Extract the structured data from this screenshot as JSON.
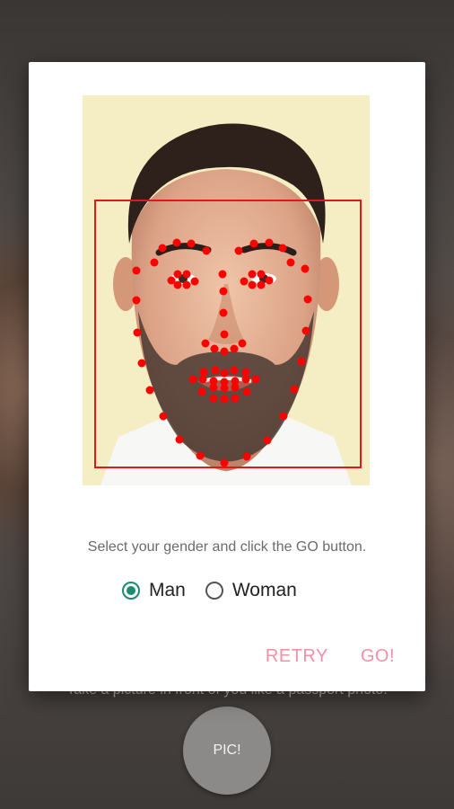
{
  "background": {
    "hint_text": "Take a picture in front of you like a passport photo.",
    "pic_button_label": "PIC!"
  },
  "dialog": {
    "prompt": "Select your gender and click the GO button.",
    "gender_options": [
      {
        "label": "Man",
        "checked": true
      },
      {
        "label": "Woman",
        "checked": false
      }
    ],
    "retry_label": "RETRY",
    "go_label": "GO!"
  },
  "colors": {
    "accent": "#1e8a70",
    "button_text": "#f48fa6",
    "landmark": "#ff0000"
  }
}
